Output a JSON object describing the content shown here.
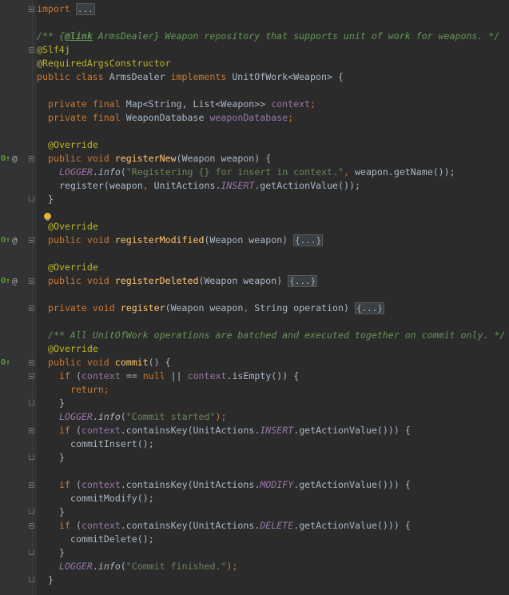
{
  "editor": {
    "language": "Java",
    "fold_placeholder": "{...}",
    "lines": [
      {
        "indent": 0,
        "fold": "open",
        "tokens": [
          {
            "t": "import",
            "c": "kw"
          },
          {
            "t": " "
          },
          {
            "t": "...",
            "c": "foldtxt"
          }
        ]
      },
      {
        "indent": 0,
        "tokens": []
      },
      {
        "indent": 0,
        "tokens": [
          {
            "t": "/** {",
            "c": "cmt"
          },
          {
            "t": "@link",
            "c": "doctag"
          },
          {
            "t": " ArmsDealer",
            "c": "cmt"
          },
          {
            "t": "} Weapon repository that supports unit of work for weapons. */",
            "c": "cmt"
          }
        ]
      },
      {
        "indent": 0,
        "fold": "open",
        "tokens": [
          {
            "t": "@Slf4j",
            "c": "ann"
          }
        ]
      },
      {
        "indent": 0,
        "tokens": [
          {
            "t": "@RequiredArgsConstructor",
            "c": "ann"
          }
        ]
      },
      {
        "indent": 0,
        "tokens": [
          {
            "t": "public class ",
            "c": "kw"
          },
          {
            "t": "ArmsDealer "
          },
          {
            "t": "implements ",
            "c": "kw"
          },
          {
            "t": "UnitOfWork<Weapon> {"
          }
        ]
      },
      {
        "indent": 0,
        "tokens": []
      },
      {
        "indent": 1,
        "tokens": [
          {
            "t": "private final ",
            "c": "kw"
          },
          {
            "t": "Map<String, List<Weapon>> "
          },
          {
            "t": "context",
            "c": "field"
          },
          {
            "t": ";",
            "c": "kw"
          }
        ]
      },
      {
        "indent": 1,
        "tokens": [
          {
            "t": "private final ",
            "c": "kw"
          },
          {
            "t": "WeaponDatabase "
          },
          {
            "t": "weaponDatabase",
            "c": "field"
          },
          {
            "t": ";",
            "c": "kw"
          }
        ]
      },
      {
        "indent": 0,
        "tokens": []
      },
      {
        "indent": 1,
        "tokens": [
          {
            "t": "@Override",
            "c": "ann"
          }
        ]
      },
      {
        "indent": 1,
        "impl": true,
        "at": true,
        "fold": "open",
        "tokens": [
          {
            "t": "public void ",
            "c": "kw"
          },
          {
            "t": "registerNew",
            "c": "meth"
          },
          {
            "t": "(Weapon weapon) {"
          }
        ]
      },
      {
        "indent": 2,
        "tokens": [
          {
            "t": "LOGGER",
            "c": "const"
          },
          {
            "t": "."
          },
          {
            "t": "info",
            "c": "static"
          },
          {
            "t": "("
          },
          {
            "t": "\"Registering {} for insert in context.\"",
            "c": "str"
          },
          {
            "t": ", ",
            "c": "kw"
          },
          {
            "t": "weapon.getName());"
          }
        ]
      },
      {
        "indent": 2,
        "tokens": [
          {
            "t": "register(weapon"
          },
          {
            "t": ", ",
            "c": "kw"
          },
          {
            "t": "UnitActions."
          },
          {
            "t": "INSERT",
            "c": "const"
          },
          {
            "t": ".getActionValue());"
          }
        ]
      },
      {
        "indent": 1,
        "fold": "end",
        "tokens": [
          {
            "t": "}"
          }
        ]
      },
      {
        "indent": 0,
        "tokens": []
      },
      {
        "indent": 1,
        "bulb": true,
        "tokens": [
          {
            "t": "@Override",
            "c": "ann"
          }
        ]
      },
      {
        "indent": 1,
        "impl": true,
        "at": true,
        "fold": "open",
        "tokens": [
          {
            "t": "public void ",
            "c": "kw"
          },
          {
            "t": "registerModified",
            "c": "meth"
          },
          {
            "t": "(Weapon weapon) "
          },
          {
            "t": "{...}",
            "c": "foldtxt"
          }
        ]
      },
      {
        "indent": 0,
        "tokens": []
      },
      {
        "indent": 1,
        "tokens": [
          {
            "t": "@Override",
            "c": "ann"
          }
        ]
      },
      {
        "indent": 1,
        "impl": true,
        "at": true,
        "fold": "open",
        "tokens": [
          {
            "t": "public void ",
            "c": "kw"
          },
          {
            "t": "registerDeleted",
            "c": "meth"
          },
          {
            "t": "(Weapon weapon) "
          },
          {
            "t": "{...}",
            "c": "foldtxt"
          }
        ]
      },
      {
        "indent": 0,
        "tokens": []
      },
      {
        "indent": 1,
        "fold": "open",
        "tokens": [
          {
            "t": "private void ",
            "c": "kw"
          },
          {
            "t": "register",
            "c": "meth"
          },
          {
            "t": "(Weapon weapon"
          },
          {
            "t": ", ",
            "c": "kw"
          },
          {
            "t": "String operation) "
          },
          {
            "t": "{...}",
            "c": "foldtxt"
          }
        ]
      },
      {
        "indent": 0,
        "tokens": []
      },
      {
        "indent": 1,
        "tokens": [
          {
            "t": "/** All UnitOfWork operations are batched and executed together on commit only. */",
            "c": "cmt"
          }
        ]
      },
      {
        "indent": 1,
        "tokens": [
          {
            "t": "@Override",
            "c": "ann"
          }
        ]
      },
      {
        "indent": 1,
        "impl": true,
        "fold": "open",
        "tokens": [
          {
            "t": "public void ",
            "c": "kw"
          },
          {
            "t": "commit",
            "c": "meth"
          },
          {
            "t": "() {"
          }
        ]
      },
      {
        "indent": 2,
        "fold": "open",
        "tokens": [
          {
            "t": "if ",
            "c": "kw"
          },
          {
            "t": "("
          },
          {
            "t": "context",
            "c": "field"
          },
          {
            "t": " == "
          },
          {
            "t": "null ",
            "c": "kw"
          },
          {
            "t": "|| "
          },
          {
            "t": "context",
            "c": "field"
          },
          {
            "t": ".isEmpty()) {"
          }
        ]
      },
      {
        "indent": 3,
        "tokens": [
          {
            "t": "return;",
            "c": "kw"
          }
        ]
      },
      {
        "indent": 2,
        "fold": "end",
        "tokens": [
          {
            "t": "}"
          }
        ]
      },
      {
        "indent": 2,
        "tokens": [
          {
            "t": "LOGGER",
            "c": "const"
          },
          {
            "t": "."
          },
          {
            "t": "info",
            "c": "static"
          },
          {
            "t": "("
          },
          {
            "t": "\"Commit started\"",
            "c": "str"
          },
          {
            "t": ");",
            "c": "kw"
          }
        ]
      },
      {
        "indent": 2,
        "fold": "open",
        "tokens": [
          {
            "t": "if ",
            "c": "kw"
          },
          {
            "t": "("
          },
          {
            "t": "context",
            "c": "field"
          },
          {
            "t": ".containsKey(UnitActions."
          },
          {
            "t": "INSERT",
            "c": "const"
          },
          {
            "t": ".getActionValue())) {"
          }
        ]
      },
      {
        "indent": 3,
        "tokens": [
          {
            "t": "commitInsert();"
          }
        ]
      },
      {
        "indent": 2,
        "fold": "end",
        "tokens": [
          {
            "t": "}"
          }
        ]
      },
      {
        "indent": 0,
        "tokens": []
      },
      {
        "indent": 2,
        "fold": "open",
        "tokens": [
          {
            "t": "if ",
            "c": "kw"
          },
          {
            "t": "("
          },
          {
            "t": "context",
            "c": "field"
          },
          {
            "t": ".containsKey(UnitActions."
          },
          {
            "t": "MODIFY",
            "c": "const"
          },
          {
            "t": ".getActionValue())) {"
          }
        ]
      },
      {
        "indent": 3,
        "tokens": [
          {
            "t": "commitModify();"
          }
        ]
      },
      {
        "indent": 2,
        "fold": "end",
        "tokens": [
          {
            "t": "}"
          }
        ]
      },
      {
        "indent": 2,
        "fold": "open",
        "tokens": [
          {
            "t": "if ",
            "c": "kw"
          },
          {
            "t": "("
          },
          {
            "t": "context",
            "c": "field"
          },
          {
            "t": ".containsKey(UnitActions."
          },
          {
            "t": "DELETE",
            "c": "const"
          },
          {
            "t": ".getActionValue())) {"
          }
        ]
      },
      {
        "indent": 3,
        "tokens": [
          {
            "t": "commitDelete();"
          }
        ]
      },
      {
        "indent": 2,
        "fold": "end",
        "tokens": [
          {
            "t": "}"
          }
        ]
      },
      {
        "indent": 2,
        "tokens": [
          {
            "t": "LOGGER",
            "c": "const"
          },
          {
            "t": "."
          },
          {
            "t": "info",
            "c": "static"
          },
          {
            "t": "("
          },
          {
            "t": "\"Commit finished.\"",
            "c": "str"
          },
          {
            "t": ");",
            "c": "kw"
          }
        ]
      },
      {
        "indent": 1,
        "fold": "end",
        "tokens": [
          {
            "t": "}"
          }
        ]
      }
    ]
  },
  "colors": {
    "background": "#2b2b2b",
    "gutter": "#313335",
    "keyword": "#cc7832",
    "annotation": "#bbb529",
    "comment": "#629755",
    "field": "#9876aa",
    "string": "#6a8759",
    "method": "#ffc66d",
    "text": "#a9b7c6"
  },
  "icons": {
    "implements": "implements-method-icon",
    "override_at": "override-annotation-icon",
    "intention": "intention-bulb-icon"
  }
}
